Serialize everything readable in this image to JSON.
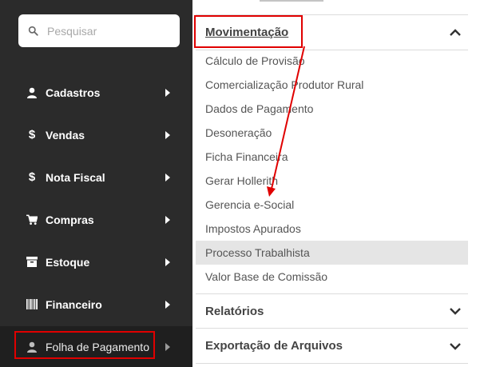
{
  "search": {
    "placeholder": "Pesquisar"
  },
  "sidebar": {
    "items": [
      {
        "label": "Cadastros",
        "icon": "user-icon"
      },
      {
        "label": "Vendas",
        "icon": "dollar-icon"
      },
      {
        "label": "Nota Fiscal",
        "icon": "dollar-icon"
      },
      {
        "label": "Compras",
        "icon": "cart-icon"
      },
      {
        "label": "Estoque",
        "icon": "archive-icon"
      },
      {
        "label": "Financeiro",
        "icon": "barcode-icon"
      },
      {
        "label": "Folha de Pagamento",
        "icon": "user-icon",
        "active": true
      }
    ]
  },
  "content": {
    "section_open": "Movimentação",
    "sub_items": [
      "Cálculo de Provisão",
      "Comercialização Produtor Rural",
      "Dados de Pagamento",
      "Desoneração",
      "Ficha Financeira",
      "Gerar Hollerith",
      "Gerencia e-Social",
      "Impostos Apurados",
      "Processo Trabalhista",
      "Valor Base de Comissão"
    ],
    "highlighted_item": "Processo Trabalhista",
    "sections_closed": [
      "Relatórios",
      "Exportação de Arquivos"
    ]
  },
  "colors": {
    "sidebar_bg": "#2b2b2b",
    "sidebar_active_bg": "#1f1f1f",
    "annotation_red": "#e00000",
    "highlight_bg": "#e5e5e5"
  }
}
